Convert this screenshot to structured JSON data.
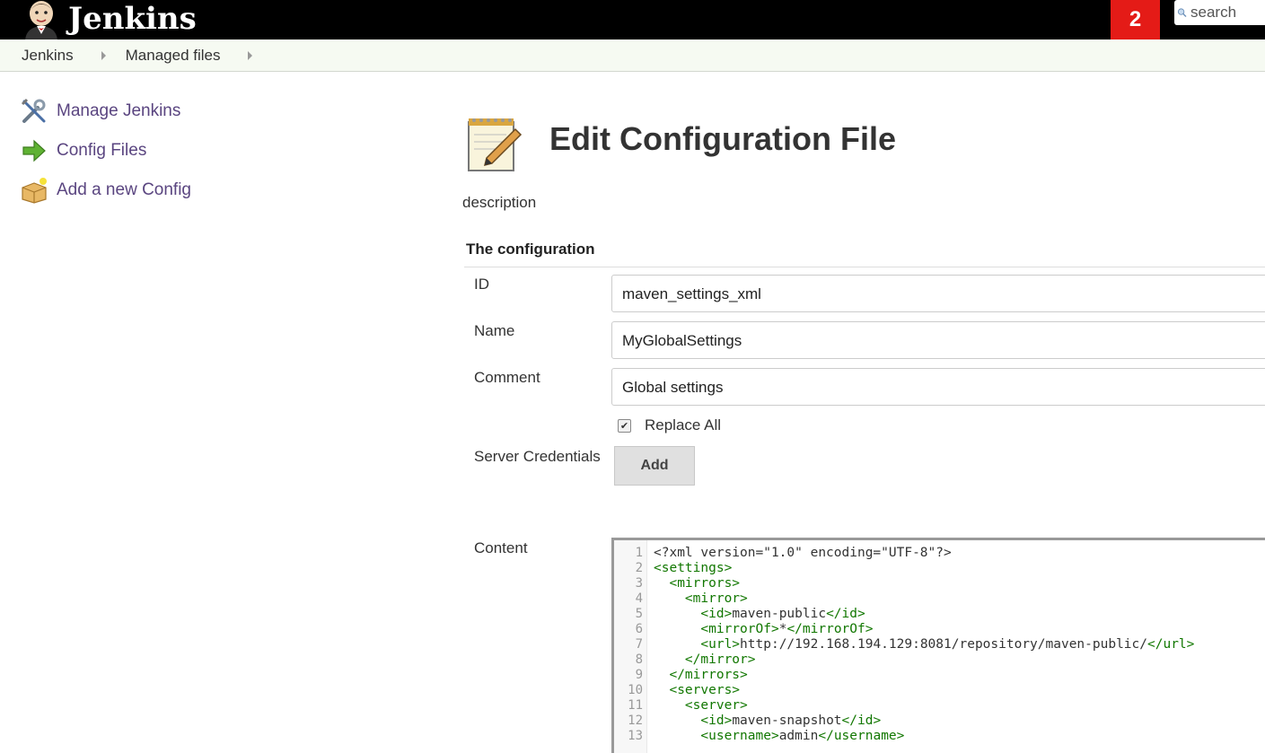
{
  "app": {
    "title": "Jenkins",
    "notification_count": "2"
  },
  "search": {
    "placeholder": "search"
  },
  "breadcrumbs": [
    {
      "label": "Jenkins"
    },
    {
      "label": "Managed files"
    }
  ],
  "sidebar": {
    "items": [
      {
        "label": "Manage Jenkins",
        "icon": "tools-icon"
      },
      {
        "label": "Config Files",
        "icon": "green-arrow-icon"
      },
      {
        "label": "Add a new Config",
        "icon": "package-add-icon"
      }
    ]
  },
  "page": {
    "title": "Edit Configuration File",
    "description_label": "description",
    "section_header": "The configuration"
  },
  "form": {
    "id_label": "ID",
    "id_value": "maven_settings_xml",
    "name_label": "Name",
    "name_value": "MyGlobalSettings",
    "comment_label": "Comment",
    "comment_value": "Global settings",
    "replace_all_label": "Replace All",
    "replace_all_checked": true,
    "server_credentials_label": "Server Credentials",
    "add_button": "Add",
    "content_label": "Content"
  },
  "editor": {
    "lines": [
      {
        "n": "1",
        "indent": "",
        "parts": [
          [
            "txt",
            "<?xml version=\"1.0\" encoding=\"UTF-8\"?>"
          ]
        ]
      },
      {
        "n": "2",
        "indent": "",
        "parts": [
          [
            "tag",
            "<settings>"
          ]
        ]
      },
      {
        "n": "3",
        "indent": "  ",
        "parts": [
          [
            "tag",
            "<mirrors>"
          ]
        ]
      },
      {
        "n": "4",
        "indent": "    ",
        "parts": [
          [
            "tag",
            "<mirror>"
          ]
        ]
      },
      {
        "n": "5",
        "indent": "      ",
        "parts": [
          [
            "tag",
            "<id>"
          ],
          [
            "txt",
            "maven-public"
          ],
          [
            "tag",
            "</id>"
          ]
        ]
      },
      {
        "n": "6",
        "indent": "      ",
        "parts": [
          [
            "tag",
            "<mirrorOf>"
          ],
          [
            "txt",
            "*"
          ],
          [
            "tag",
            "</mirrorOf>"
          ]
        ]
      },
      {
        "n": "7",
        "indent": "      ",
        "parts": [
          [
            "tag",
            "<url>"
          ],
          [
            "txt",
            "http://192.168.194.129:8081/repository/maven-public/"
          ],
          [
            "tag",
            "</url>"
          ]
        ]
      },
      {
        "n": "8",
        "indent": "    ",
        "parts": [
          [
            "tag",
            "</mirror>"
          ]
        ]
      },
      {
        "n": "9",
        "indent": "  ",
        "parts": [
          [
            "tag",
            "</mirrors>"
          ]
        ]
      },
      {
        "n": "10",
        "indent": "  ",
        "parts": [
          [
            "tag",
            "<servers>"
          ]
        ]
      },
      {
        "n": "11",
        "indent": "    ",
        "parts": [
          [
            "tag",
            "<server>"
          ]
        ]
      },
      {
        "n": "12",
        "indent": "      ",
        "parts": [
          [
            "tag",
            "<id>"
          ],
          [
            "txt",
            "maven-snapshot"
          ],
          [
            "tag",
            "</id>"
          ]
        ]
      },
      {
        "n": "13",
        "indent": "      ",
        "parts": [
          [
            "tag",
            "<username>"
          ],
          [
            "txt",
            "admin"
          ],
          [
            "tag",
            "</username>"
          ]
        ]
      }
    ]
  }
}
